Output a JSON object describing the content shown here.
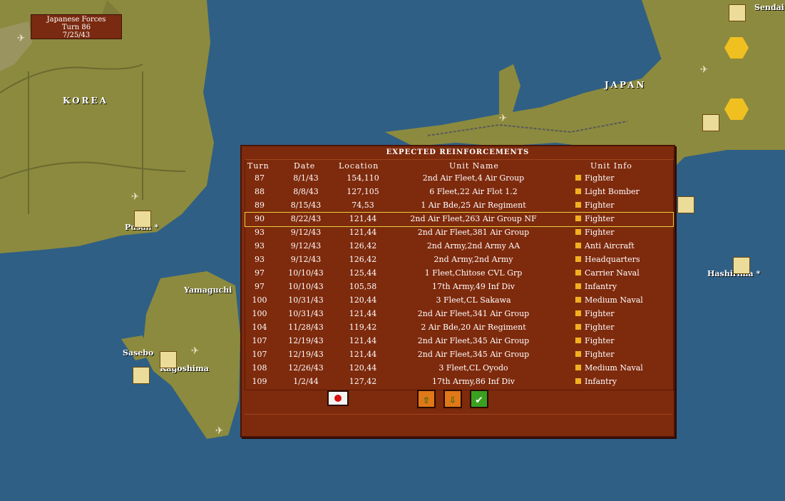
{
  "turn_info": {
    "line1": "Japanese Forces",
    "line2": "Turn 86",
    "line3": "7/25/43"
  },
  "map_labels": {
    "korea": "KOREA",
    "japan": "JAPAN",
    "sendai": "Sendai",
    "pusan": "Pusan *",
    "hashima": "Hashirima *",
    "sasebo": "Sasebo",
    "nagasaki": "Kagoshima",
    "yamaguchi": "Yamaguchi"
  },
  "panel": {
    "title": "EXPECTED REINFORCEMENTS",
    "headers": {
      "turn": "Turn",
      "date": "Date",
      "location": "Location",
      "unit_name": "Unit Name",
      "unit_info": "Unit Info"
    },
    "rows": [
      {
        "turn": "87",
        "date": "8/1/43",
        "location": "154,110",
        "name": "2nd Air Fleet,4 Air Group",
        "info": "Fighter"
      },
      {
        "turn": "88",
        "date": "8/8/43",
        "location": "127,105",
        "name": "6 Fleet,22 Air Flot 1.2",
        "info": "Light Bomber"
      },
      {
        "turn": "89",
        "date": "8/15/43",
        "location": "74,53",
        "name": "1 Air Bde,25 Air Regiment",
        "info": "Fighter"
      },
      {
        "turn": "90",
        "date": "8/22/43",
        "location": "121,44",
        "name": "2nd Air Fleet,263 Air Group NF",
        "info": "Fighter"
      },
      {
        "turn": "93",
        "date": "9/12/43",
        "location": "121,44",
        "name": "2nd Air Fleet,381 Air Group",
        "info": "Fighter"
      },
      {
        "turn": "93",
        "date": "9/12/43",
        "location": "126,42",
        "name": "2nd Army,2nd Army AA",
        "info": "Anti Aircraft"
      },
      {
        "turn": "93",
        "date": "9/12/43",
        "location": "126,42",
        "name": "2nd Army,2nd Army",
        "info": "Headquarters"
      },
      {
        "turn": "97",
        "date": "10/10/43",
        "location": "125,44",
        "name": "1 Fleet,Chitose CVL Grp",
        "info": "Carrier Naval"
      },
      {
        "turn": "97",
        "date": "10/10/43",
        "location": "105,58",
        "name": "17th Army,49 Inf Div",
        "info": "Infantry"
      },
      {
        "turn": "100",
        "date": "10/31/43",
        "location": "120,44",
        "name": "3 Fleet,CL Sakawa",
        "info": "Medium Naval"
      },
      {
        "turn": "100",
        "date": "10/31/43",
        "location": "121,44",
        "name": "2nd Air Fleet,341 Air Group",
        "info": "Fighter"
      },
      {
        "turn": "104",
        "date": "11/28/43",
        "location": "119,42",
        "name": "2 Air Bde,20 Air Regiment",
        "info": "Fighter"
      },
      {
        "turn": "107",
        "date": "12/19/43",
        "location": "121,44",
        "name": "2nd Air Fleet,345 Air Group",
        "info": "Fighter"
      },
      {
        "turn": "107",
        "date": "12/19/43",
        "location": "121,44",
        "name": "2nd Air Fleet,345 Air Group",
        "info": "Fighter"
      },
      {
        "turn": "108",
        "date": "12/26/43",
        "location": "120,44",
        "name": "3 Fleet,CL Oyodo",
        "info": "Medium Naval"
      },
      {
        "turn": "109",
        "date": "1/2/44",
        "location": "127,42",
        "name": "17th Army,86 Inf Div",
        "info": "Infantry"
      }
    ],
    "highlighted_row": 3,
    "buttons": {
      "flag": "flag-icon",
      "up": "up-arrow-icon",
      "down": "down-arrow-icon",
      "ok": "checkmark-icon"
    }
  },
  "colors": {
    "panel": "#7e2a0d",
    "sea": "#2f5f85",
    "land": "#8c8a3e",
    "button": "#e07818",
    "ok": "#3aa020"
  }
}
